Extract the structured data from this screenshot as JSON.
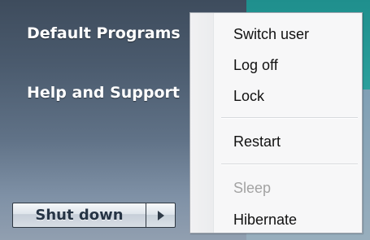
{
  "start_menu": {
    "links": [
      {
        "label": "Default Programs"
      },
      {
        "label": "Help and Support"
      }
    ],
    "shutdown_button": {
      "label": "Shut down",
      "arrow_icon": "chevron-right-icon"
    }
  },
  "power_menu": {
    "items": [
      {
        "label": "Switch user",
        "enabled": true
      },
      {
        "label": "Log off",
        "enabled": true
      },
      {
        "label": "Lock",
        "enabled": true
      },
      {
        "label": "Restart",
        "enabled": true
      },
      {
        "label": "Sleep",
        "enabled": false
      },
      {
        "label": "Hibernate",
        "enabled": true
      }
    ]
  },
  "colors": {
    "menu_background": "#f7f7f8",
    "disabled_text": "#a3a3a3",
    "start_pane": "#4a5a6d",
    "accent_teal": "#2b9f9c"
  }
}
